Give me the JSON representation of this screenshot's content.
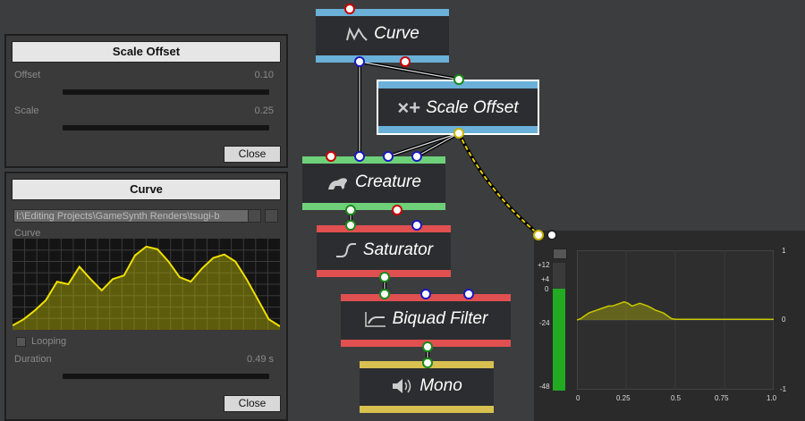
{
  "scale_offset_panel": {
    "title": "Scale Offset",
    "offset_label": "Offset",
    "offset_value": "0.10",
    "scale_label": "Scale",
    "scale_value": "0.25",
    "close_label": "Close"
  },
  "curve_panel": {
    "title": "Curve",
    "path": "I:\\Editing Projects\\GameSynth Renders\\tsugi-b",
    "curve_label": "Curve",
    "looping_label": "Looping",
    "duration_label": "Duration",
    "duration_value": "0.49 s",
    "close_label": "Close",
    "curve_values": [
      0.05,
      0.12,
      0.22,
      0.34,
      0.55,
      0.52,
      0.72,
      0.58,
      0.45,
      0.58,
      0.62,
      0.85,
      0.95,
      0.92,
      0.78,
      0.6,
      0.55,
      0.7,
      0.82,
      0.86,
      0.78,
      0.58,
      0.35,
      0.12,
      0.04
    ]
  },
  "nodes": {
    "curve": {
      "label": "Curve",
      "icon": "curve-icon",
      "color": "#6ab0d8"
    },
    "scale_offset": {
      "label": "Scale Offset",
      "icon": "scale-offset-icon",
      "color": "#6ab0d8"
    },
    "creature": {
      "label": "Creature",
      "icon": "creature-icon",
      "color": "#6fd07a"
    },
    "saturator": {
      "label": "Saturator",
      "icon": "saturator-icon",
      "color": "#e05050"
    },
    "biquad": {
      "label": "Biquad Filter",
      "icon": "filter-icon",
      "color": "#e05050"
    },
    "mono": {
      "label": "Mono",
      "icon": "speaker-icon",
      "color": "#d8c050"
    }
  },
  "meter": {
    "db_ticks": [
      "+12",
      "+4",
      "0",
      "-24",
      "-48"
    ],
    "y_ticks": [
      "1",
      "0",
      "-1"
    ],
    "x_ticks": [
      "0",
      "0.25",
      "0.5",
      "0.75",
      "1.0"
    ],
    "level_fraction": 0.8,
    "meter_color": "#22aa22"
  },
  "chart_data": {
    "type": "area",
    "x": [
      0,
      0.02,
      0.04,
      0.06,
      0.08,
      0.1,
      0.12,
      0.14,
      0.16,
      0.18,
      0.2,
      0.22,
      0.24,
      0.26,
      0.28,
      0.3,
      0.32,
      0.34,
      0.36,
      0.38,
      0.4,
      0.42,
      0.44,
      0.46,
      0.48,
      0.5,
      1.0
    ],
    "y": [
      0,
      0.02,
      0.06,
      0.1,
      0.12,
      0.14,
      0.16,
      0.18,
      0.2,
      0.2,
      0.22,
      0.24,
      0.26,
      0.24,
      0.2,
      0.22,
      0.24,
      0.22,
      0.2,
      0.17,
      0.14,
      0.12,
      0.1,
      0.06,
      0.02,
      0.01,
      0.01
    ],
    "ylim": [
      -1,
      1
    ],
    "xlim": [
      0,
      1.0
    ],
    "x_ticks": [
      "0",
      "0.25",
      "0.5",
      "0.75",
      "1.0"
    ],
    "y_ticks": [
      "1",
      "0",
      "-1"
    ],
    "color": "#c8c800"
  }
}
